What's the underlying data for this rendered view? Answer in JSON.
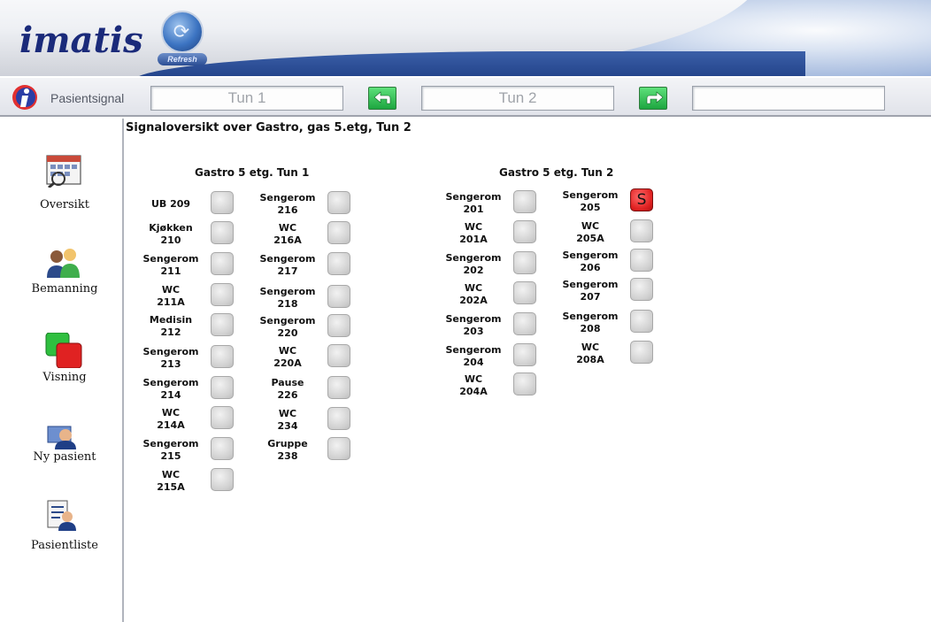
{
  "banner": {
    "logo": "imatis",
    "refresh_label": "Refresh"
  },
  "toolbar": {
    "title": "Pasientsignal",
    "tun1_label": "Tun 1",
    "tun2_label": "Tun 2",
    "tun3_label": "",
    "back_button": "arrow-left-icon",
    "forward_button": "arrow-right-icon"
  },
  "sidebar": {
    "items": [
      {
        "label": "Oversikt",
        "icon": "calendar-overview-icon"
      },
      {
        "label": "Bemanning",
        "icon": "staff-icon"
      },
      {
        "label": "Visning",
        "icon": "display-toggle-icon"
      },
      {
        "label": "Ny pasient",
        "icon": "new-patient-icon"
      },
      {
        "label": "Pasientliste",
        "icon": "patient-list-icon"
      }
    ]
  },
  "main": {
    "title": "Signaloversikt over Gastro, gas 5.etg, Tun 2",
    "tun1": {
      "heading": "Gastro 5 etg. Tun 1",
      "col1": [
        {
          "line1": "UB 209",
          "line2": "",
          "signal": ""
        },
        {
          "line1": "Kjøkken",
          "line2": "210",
          "signal": ""
        },
        {
          "line1": "Sengerom",
          "line2": "211",
          "signal": ""
        },
        {
          "line1": "WC",
          "line2": "211A",
          "signal": ""
        },
        {
          "line1": "Medisin",
          "line2": "212",
          "signal": ""
        },
        {
          "line1": "Sengerom",
          "line2": "213",
          "signal": ""
        },
        {
          "line1": "Sengerom",
          "line2": "214",
          "signal": ""
        },
        {
          "line1": "WC",
          "line2": "214A",
          "signal": ""
        },
        {
          "line1": "Sengerom",
          "line2": "215",
          "signal": ""
        },
        {
          "line1": "WC",
          "line2": "215A",
          "signal": ""
        }
      ],
      "col2": [
        {
          "line1": "Sengerom",
          "line2": "216",
          "signal": ""
        },
        {
          "line1": "WC",
          "line2": "216A",
          "signal": ""
        },
        {
          "line1": "Sengerom",
          "line2": "217",
          "signal": ""
        },
        {
          "line1": "Sengerom",
          "line2": "218",
          "signal": ""
        },
        {
          "line1": "Sengerom",
          "line2": "220",
          "signal": ""
        },
        {
          "line1": "WC",
          "line2": "220A",
          "signal": ""
        },
        {
          "line1": "Pause",
          "line2": "226",
          "signal": ""
        },
        {
          "line1": "WC",
          "line2": "234",
          "signal": ""
        },
        {
          "line1": "Gruppe",
          "line2": "238",
          "signal": ""
        }
      ]
    },
    "tun2": {
      "heading": "Gastro 5 etg. Tun 2",
      "col1": [
        {
          "line1": "Sengerom",
          "line2": "201",
          "signal": ""
        },
        {
          "line1": "WC",
          "line2": "201A",
          "signal": ""
        },
        {
          "line1": "Sengerom",
          "line2": "202",
          "signal": ""
        },
        {
          "line1": "WC",
          "line2": "202A",
          "signal": ""
        },
        {
          "line1": "Sengerom",
          "line2": "203",
          "signal": ""
        },
        {
          "line1": "Sengerom",
          "line2": "204",
          "signal": ""
        },
        {
          "line1": "WC",
          "line2": "204A",
          "signal": ""
        }
      ],
      "col2": [
        {
          "line1": "Sengerom",
          "line2": "205",
          "signal": "S"
        },
        {
          "line1": "WC",
          "line2": "205A",
          "signal": ""
        },
        {
          "line1": "Sengerom",
          "line2": "206",
          "signal": ""
        },
        {
          "line1": "Sengerom",
          "line2": "207",
          "signal": ""
        },
        {
          "line1": "Sengerom",
          "line2": "208",
          "signal": ""
        },
        {
          "line1": "WC",
          "line2": "208A",
          "signal": ""
        }
      ]
    }
  },
  "colors": {
    "active_signal": "#e02222",
    "idle_signal": "#d0d0d0",
    "nav_green": "#1da640"
  }
}
